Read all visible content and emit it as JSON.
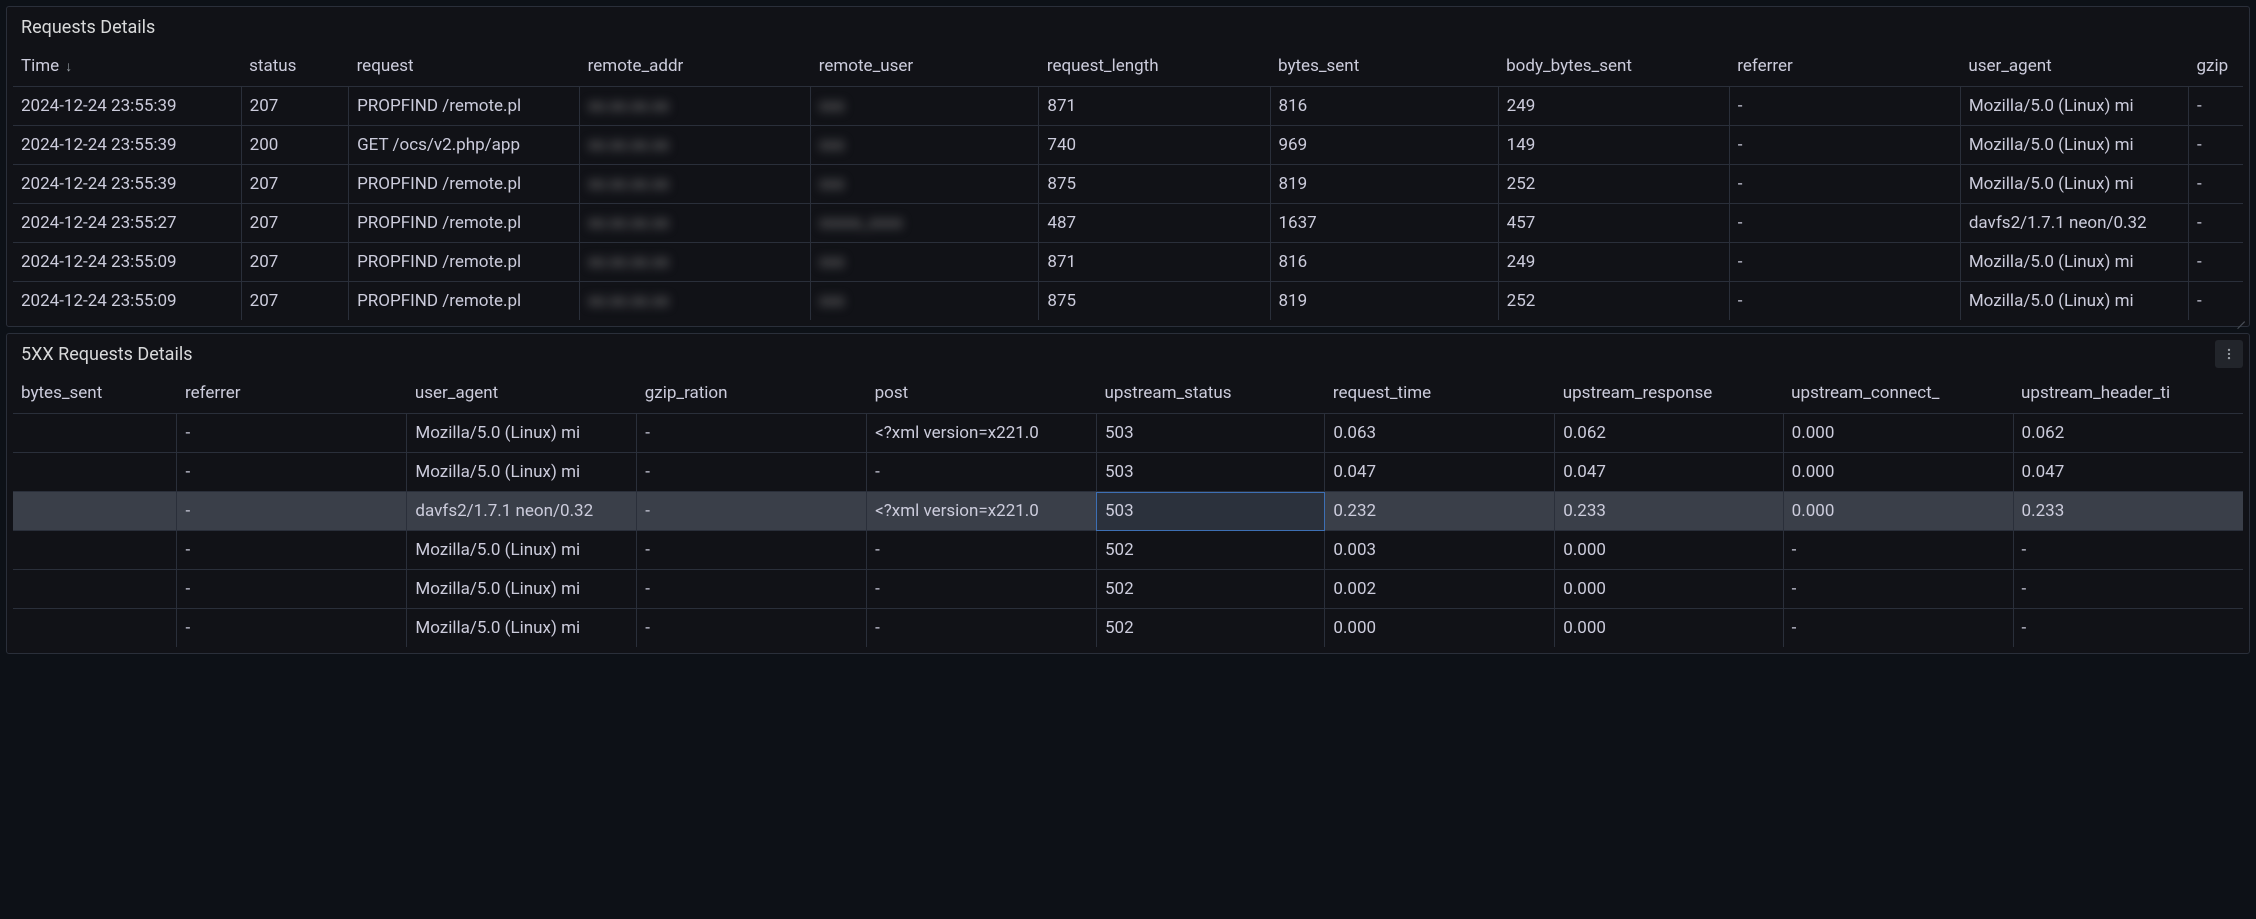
{
  "panel1": {
    "title": "Requests Details",
    "sort_indicator": "↓",
    "columns": [
      "Time",
      "status",
      "request",
      "remote_addr",
      "remote_user",
      "request_length",
      "bytes_sent",
      "body_bytes_sent",
      "referrer",
      "user_agent",
      "gzip"
    ],
    "rows": [
      {
        "time": "2024-12-24 23:55:39",
        "status": "207",
        "request": "PROPFIND /remote.pl",
        "addr": "xx.xx.xx.xx",
        "user": "xxx",
        "rlen": "871",
        "bsent": "816",
        "bbsent": "249",
        "ref": "-",
        "ua": "Mozilla/5.0 (Linux) mi",
        "gz": "-"
      },
      {
        "time": "2024-12-24 23:55:39",
        "status": "200",
        "request": "GET /ocs/v2.php/app",
        "addr": "xx.xx.xx.xx",
        "user": "xxx",
        "rlen": "740",
        "bsent": "969",
        "bbsent": "149",
        "ref": "-",
        "ua": "Mozilla/5.0 (Linux) mi",
        "gz": "-"
      },
      {
        "time": "2024-12-24 23:55:39",
        "status": "207",
        "request": "PROPFIND /remote.pl",
        "addr": "xx.xx.xx.xx",
        "user": "xxx",
        "rlen": "875",
        "bsent": "819",
        "bbsent": "252",
        "ref": "-",
        "ua": "Mozilla/5.0 (Linux) mi",
        "gz": "-"
      },
      {
        "time": "2024-12-24 23:55:27",
        "status": "207",
        "request": "PROPFIND /remote.pl",
        "addr": "xx.xx.xx.xx",
        "user": "xxxxx_xxxx",
        "rlen": "487",
        "bsent": "1637",
        "bbsent": "457",
        "ref": "-",
        "ua": "davfs2/1.7.1 neon/0.32",
        "gz": "-"
      },
      {
        "time": "2024-12-24 23:55:09",
        "status": "207",
        "request": "PROPFIND /remote.pl",
        "addr": "xx.xx.xx.xx",
        "user": "xxx",
        "rlen": "871",
        "bsent": "816",
        "bbsent": "249",
        "ref": "-",
        "ua": "Mozilla/5.0 (Linux) mi",
        "gz": "-"
      },
      {
        "time": "2024-12-24 23:55:09",
        "status": "207",
        "request": "PROPFIND /remote.pl",
        "addr": "xx.xx.xx.xx",
        "user": "xxx",
        "rlen": "875",
        "bsent": "819",
        "bbsent": "252",
        "ref": "-",
        "ua": "Mozilla/5.0 (Linux) mi",
        "gz": "-"
      }
    ]
  },
  "panel2": {
    "title": "5XX Requests Details",
    "columns": [
      "bytes_sent",
      "referrer",
      "user_agent",
      "gzip_ration",
      "post",
      "upstream_status",
      "request_time",
      "upstream_response",
      "upstream_connect_",
      "upstream_header_ti"
    ],
    "highlight_row": 2,
    "selected_col": 5,
    "rows": [
      {
        "bsent": "",
        "ref": "-",
        "ua": "Mozilla/5.0 (Linux) mi",
        "gz": "-",
        "post": "<?xml version=x221.0",
        "ustatus": "503",
        "rtime": "0.063",
        "uresp": "0.062",
        "uconn": "0.000",
        "uhead": "0.062"
      },
      {
        "bsent": "",
        "ref": "-",
        "ua": "Mozilla/5.0 (Linux) mi",
        "gz": "-",
        "post": "-",
        "ustatus": "503",
        "rtime": "0.047",
        "uresp": "0.047",
        "uconn": "0.000",
        "uhead": "0.047"
      },
      {
        "bsent": "",
        "ref": "-",
        "ua": "davfs2/1.7.1 neon/0.32",
        "gz": "-",
        "post": "<?xml version=x221.0",
        "ustatus": "503",
        "rtime": "0.232",
        "uresp": "0.233",
        "uconn": "0.000",
        "uhead": "0.233"
      },
      {
        "bsent": "",
        "ref": "-",
        "ua": "Mozilla/5.0 (Linux) mi",
        "gz": "-",
        "post": "-",
        "ustatus": "502",
        "rtime": "0.003",
        "uresp": "0.000",
        "uconn": "-",
        "uhead": "-"
      },
      {
        "bsent": "",
        "ref": "-",
        "ua": "Mozilla/5.0 (Linux) mi",
        "gz": "-",
        "post": "-",
        "ustatus": "502",
        "rtime": "0.002",
        "uresp": "0.000",
        "uconn": "-",
        "uhead": "-"
      },
      {
        "bsent": "",
        "ref": "-",
        "ua": "Mozilla/5.0 (Linux) mi",
        "gz": "-",
        "post": "-",
        "ustatus": "502",
        "rtime": "0.000",
        "uresp": "0.000",
        "uconn": "-",
        "uhead": "-"
      }
    ]
  }
}
